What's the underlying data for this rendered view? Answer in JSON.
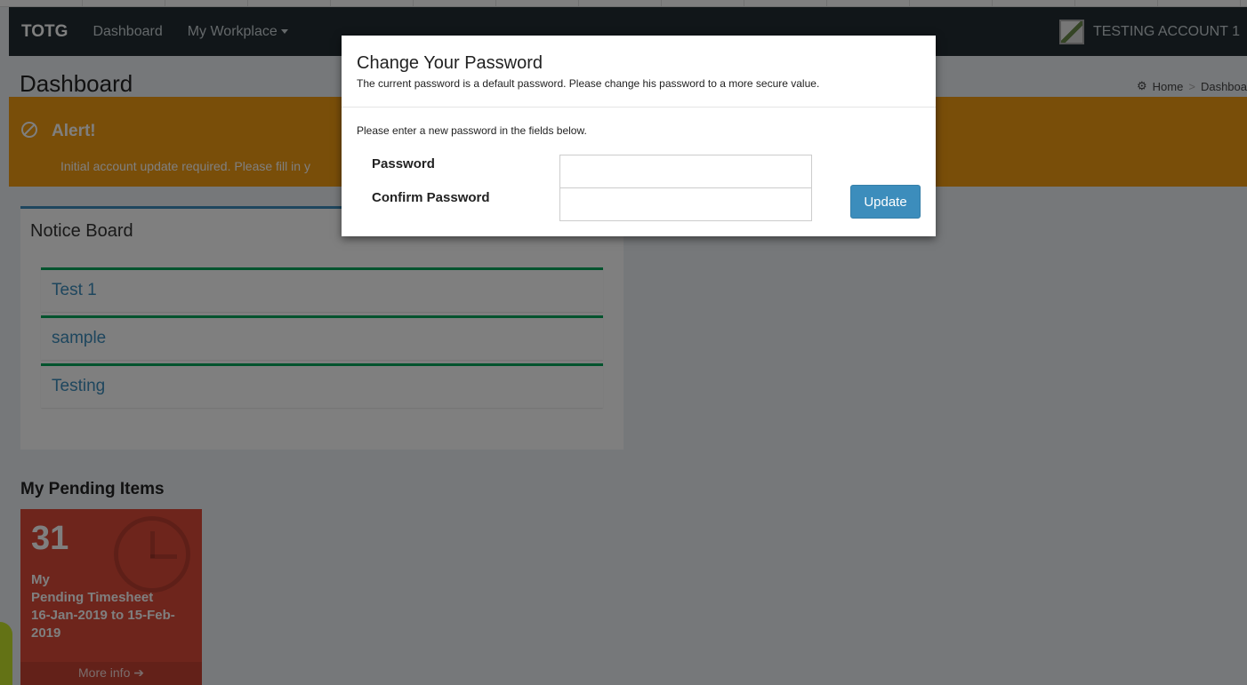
{
  "navbar": {
    "brand": "TOTG",
    "items": [
      {
        "label": "Dashboard"
      },
      {
        "label": "My Workplace"
      }
    ],
    "user": "TESTING ACCOUNT 1"
  },
  "header": {
    "title": "Dashboard",
    "breadcrumb": [
      "Home",
      ">",
      "Dashboa"
    ]
  },
  "alert": {
    "title": "Alert!",
    "text": "Initial account update required. Please fill in y"
  },
  "notice_board": {
    "title": "Notice Board",
    "items": [
      {
        "label": "Test 1"
      },
      {
        "label": "sample"
      },
      {
        "label": "Testing"
      }
    ]
  },
  "pending": {
    "title": "My Pending Items",
    "count": "31",
    "line1": "My",
    "line2": "Pending Timesheet",
    "line3": "16-Jan-2019 to 15-Feb-",
    "line4": "2019",
    "footer": "More info ➔"
  },
  "modal": {
    "title": "Change Your Password",
    "subtitle": "The current password is a default password. Please change his password to a more secure value.",
    "instruction": "Please enter a new password in the fields below.",
    "password_label": "Password",
    "password_value": "",
    "confirm_label": "Confirm Password",
    "confirm_value": "",
    "update_label": "Update"
  },
  "colors": {
    "navbar": "#222d32",
    "alert": "#f39c12",
    "primary": "#3c8dbc",
    "danger": "#dd4b39",
    "success": "#00a65a"
  }
}
